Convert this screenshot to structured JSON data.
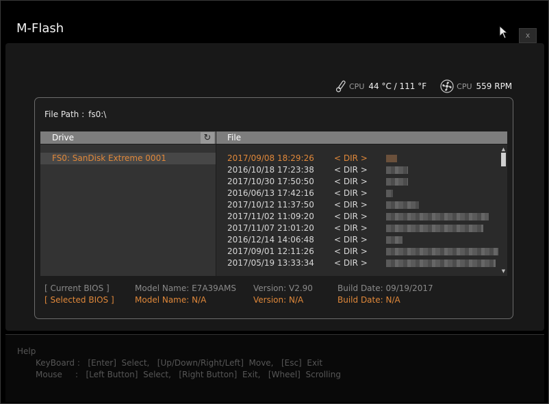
{
  "window": {
    "title": "M-Flash",
    "close_label": "x"
  },
  "sensors": {
    "cpu_temp_label": "CPU",
    "cpu_temp_value": "44 °C / 111 °F",
    "cpu_fan_label": "CPU",
    "cpu_fan_value": "559 RPM"
  },
  "file_path": {
    "label": "File Path :",
    "value": "fs0:\\"
  },
  "drive_panel": {
    "header": "Drive",
    "items": [
      {
        "label": "FS0: SanDisk Extreme 0001"
      }
    ]
  },
  "file_panel": {
    "header": "File",
    "rows": [
      {
        "date": "2017/09/08 18:29:26",
        "type": "< DIR >"
      },
      {
        "date": "2016/10/18 17:23:38",
        "type": "< DIR >"
      },
      {
        "date": "2017/10/30 17:50:50",
        "type": "< DIR >"
      },
      {
        "date": "2016/06/13 17:42:16",
        "type": "< DIR >"
      },
      {
        "date": "2017/10/12 11:37:50",
        "type": "< DIR >"
      },
      {
        "date": "2017/11/02 11:09:20",
        "type": "< DIR >"
      },
      {
        "date": "2017/11/07 21:01:20",
        "type": "< DIR >"
      },
      {
        "date": "2016/12/14 14:06:48",
        "type": "< DIR >"
      },
      {
        "date": "2017/09/01 12:11:26",
        "type": "< DIR >"
      },
      {
        "date": "2017/05/19 13:33:34",
        "type": "< DIR >"
      }
    ]
  },
  "bios": {
    "current": {
      "label": "[ Current BIOS   ]",
      "model": "Model Name: E7A39AMS",
      "version": "Version: V2.90",
      "build": "Build Date: 09/19/2017"
    },
    "selected": {
      "label": "[ Selected BIOS ]",
      "model": "Model Name: N/A",
      "version": "Version: N/A",
      "build": "Build Date: N/A"
    }
  },
  "help": {
    "title": "Help",
    "keyboard": "KeyBoard :   [Enter]  Select,   [Up/Down/Right/Left]  Move,   [Esc]  Exit",
    "mouse": "Mouse     :   [Left Button]  Select,   [Right Button]  Exit,   [Wheel]  Scrolling"
  },
  "colors": {
    "accent": "#e0883a",
    "header_bg": "#7d7d7d",
    "text": "#d8d8d8"
  }
}
